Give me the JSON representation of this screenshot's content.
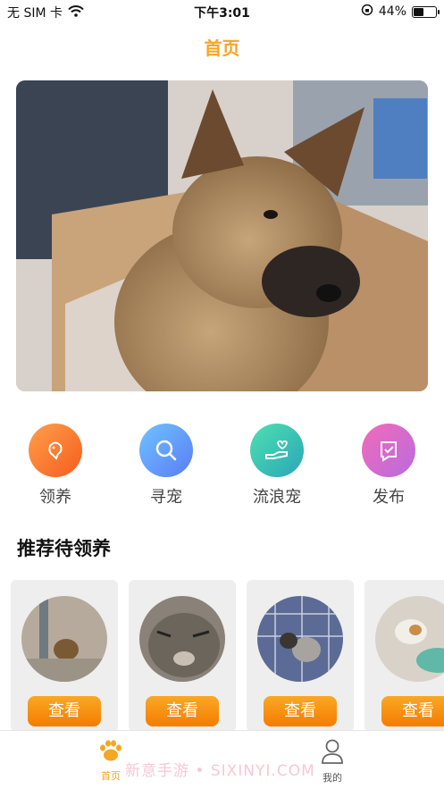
{
  "status_bar": {
    "carrier": "无 SIM 卡",
    "time": "下午3:01",
    "battery_percent": "44%",
    "battery_level": 0.44
  },
  "nav": {
    "title": "首页"
  },
  "actions": [
    {
      "label": "领养",
      "icon": "adopt-icon",
      "color_from": "#fda04a",
      "color_to": "#f75c1e"
    },
    {
      "label": "寻宠",
      "icon": "search-pet-icon",
      "color_from": "#6fc3ff",
      "color_to": "#5a7cf5"
    },
    {
      "label": "流浪宠",
      "icon": "stray-pet-icon",
      "color_from": "#4fe0b0",
      "color_to": "#2aa6b8"
    },
    {
      "label": "发布",
      "icon": "publish-icon",
      "color_from": "#f26bb8",
      "color_to": "#b86be0"
    }
  ],
  "section": {
    "title": "推荐待领养"
  },
  "cards": [
    {
      "button_label": "查看"
    },
    {
      "button_label": "查看"
    },
    {
      "button_label": "查看"
    },
    {
      "button_label": "查看"
    }
  ],
  "tabbar": {
    "home_label": "首页",
    "mine_label": "我的",
    "watermark": "新意手游 • SIXINYI.COM"
  },
  "colors": {
    "accent": "#f5a623",
    "button": "#f7931e"
  }
}
